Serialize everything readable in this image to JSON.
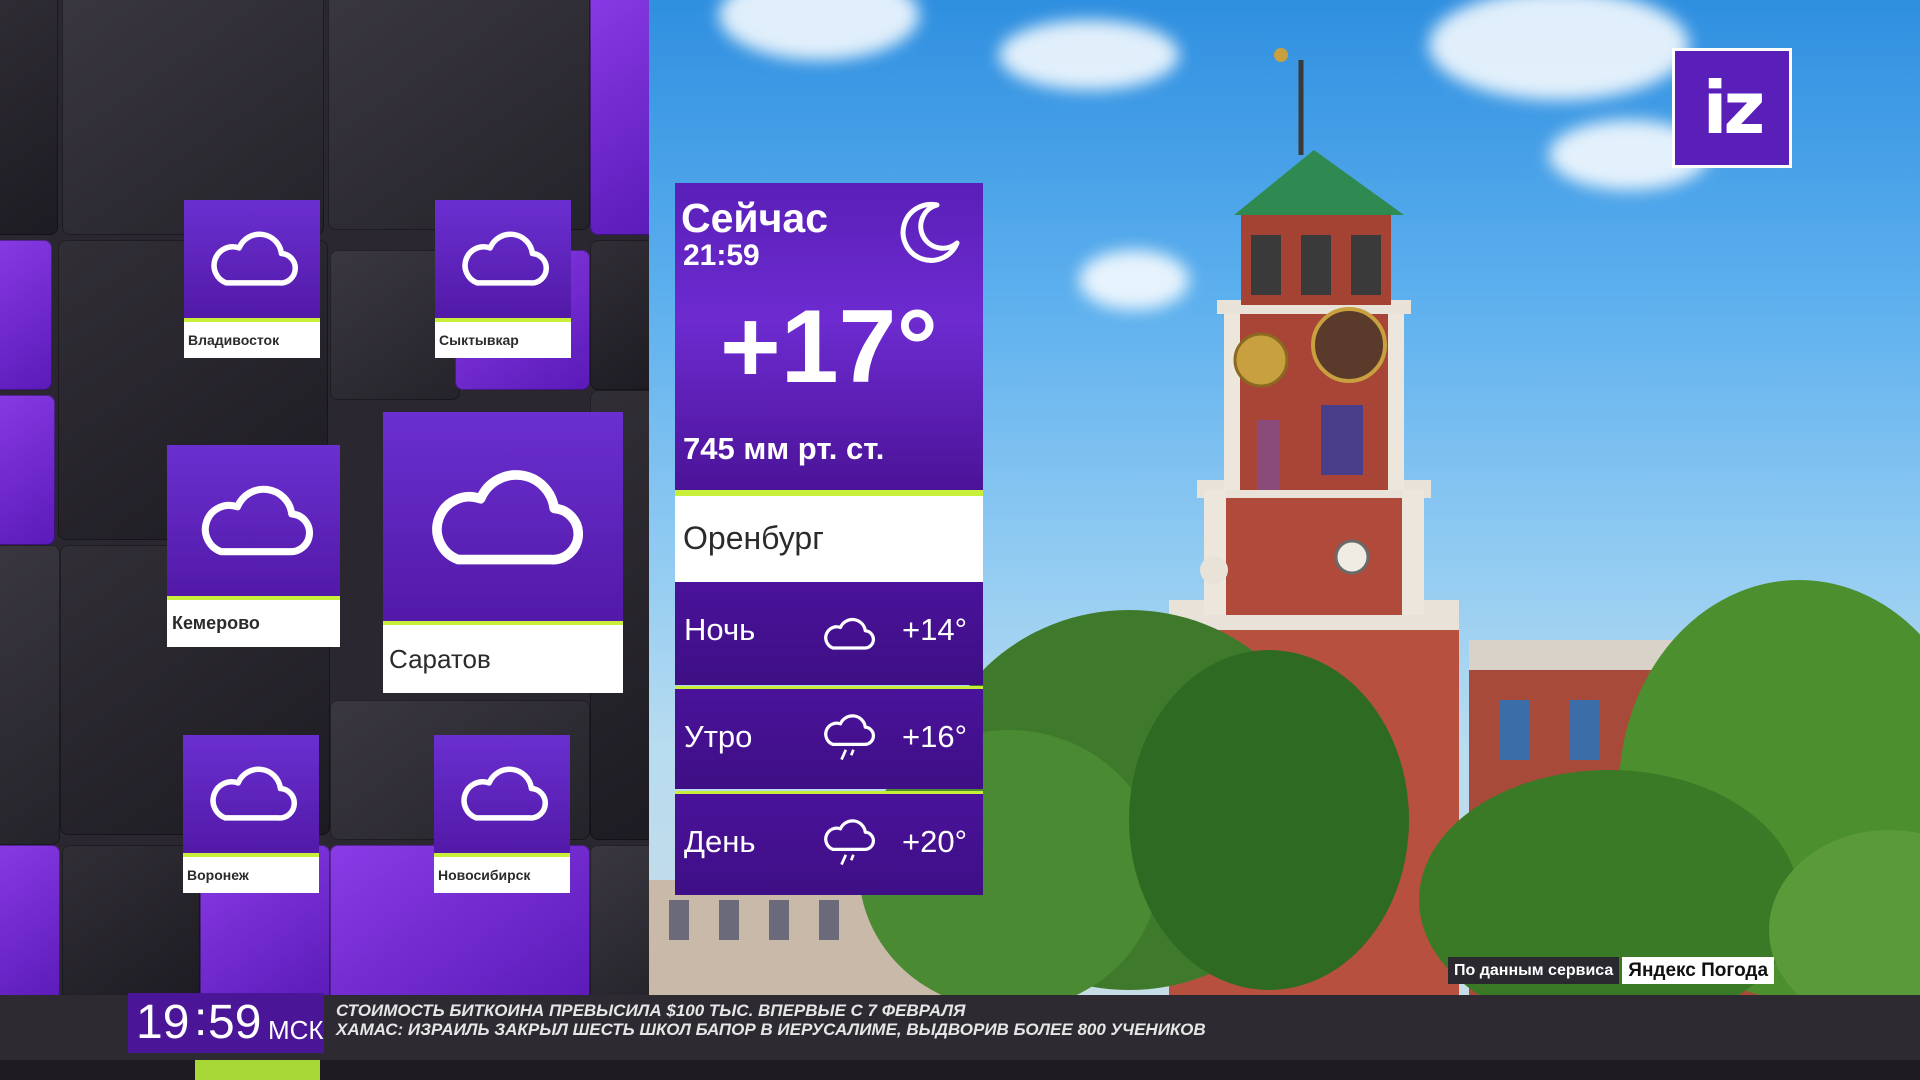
{
  "logo": {
    "text": "iz"
  },
  "current": {
    "title": "Сейчас",
    "time": "21:59",
    "temperature": "+17°",
    "pressure": "745 мм рт. ст.",
    "icon": "moon-icon"
  },
  "city": "Оренбург",
  "forecast": [
    {
      "period": "Ночь",
      "icon": "cloud-icon",
      "temp": "+14°"
    },
    {
      "period": "Утро",
      "icon": "cloud-rain-icon",
      "temp": "+16°"
    },
    {
      "period": "День",
      "icon": "cloud-rain-icon",
      "temp": "+20°"
    }
  ],
  "cities": [
    {
      "name": "Владивосток",
      "icon": "cloud-icon"
    },
    {
      "name": "Сыктывкар",
      "icon": "cloud-icon"
    },
    {
      "name": "Кемерово",
      "icon": "cloud-icon"
    },
    {
      "name": "Саратов",
      "icon": "cloud-icon"
    },
    {
      "name": "Воронеж",
      "icon": "cloud-icon"
    },
    {
      "name": "Новосибирск",
      "icon": "cloud-icon"
    }
  ],
  "source": {
    "prefix": "По данным сервиса",
    "service": "Яндекс Погода"
  },
  "clock": {
    "hh": "19",
    "mm": "59",
    "tz": "МСК"
  },
  "ticker": [
    "СТОИМОСТЬ БИТКОИНА ПРЕВЫСИЛА $100 ТЫС. ВПЕРВЫЕ С 7 ФЕВРАЛЯ",
    "ХАМАС: ИЗРАИЛЬ ЗАКРЫЛ ШЕСТЬ ШКОЛ БАПОР В ИЕРУСАЛИМЕ, ВЫДВОРИВ БОЛЕЕ 800 УЧЕНИКОВ"
  ],
  "colors": {
    "accent": "#c8ef3a",
    "purple": "#5a1fb8",
    "dark": "#2d2b31"
  }
}
